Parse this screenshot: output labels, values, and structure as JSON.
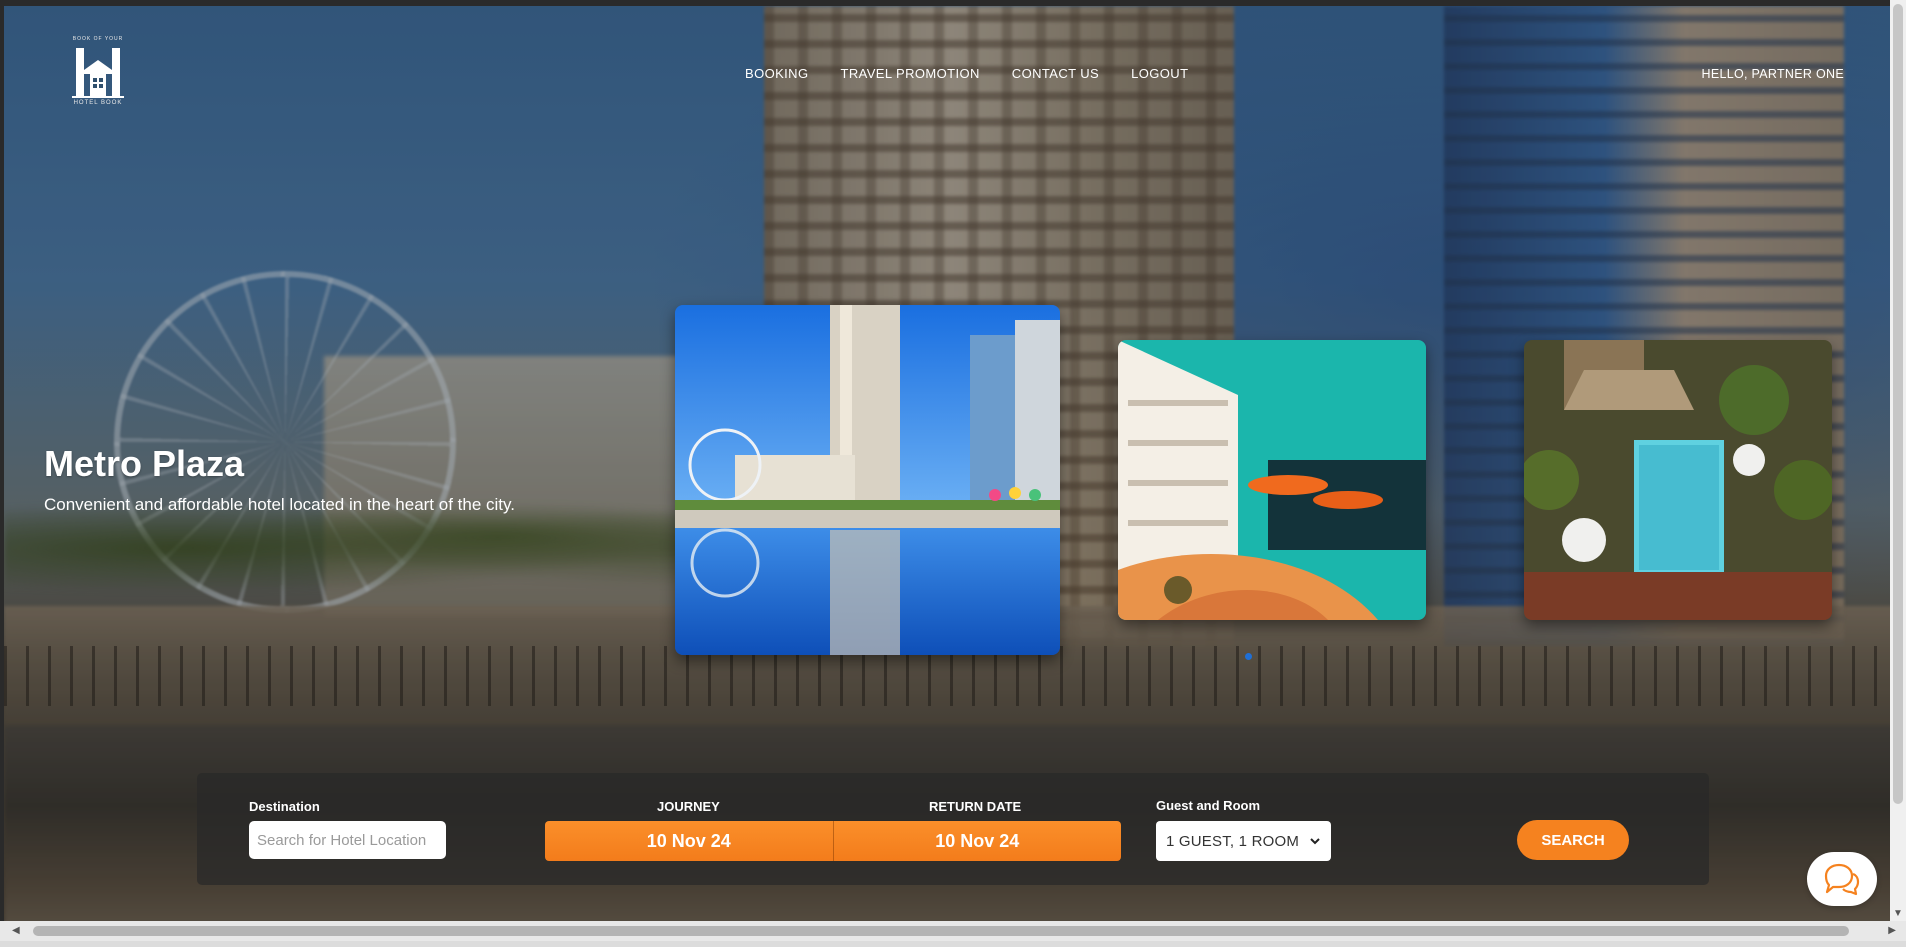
{
  "logo": {
    "tagline": "BOOK OF YOUR",
    "name": "HOTEL BOOK"
  },
  "nav": {
    "items": [
      "BOOKING",
      "TRAVEL PROMOTION",
      "CONTACT US",
      "LOGOUT"
    ]
  },
  "user": {
    "greeting": "HELLO, PARTNER ONE"
  },
  "hero": {
    "title": "Metro Plaza",
    "description": "Convenient and affordable hotel located in the heart of the city.",
    "active_slide": 1
  },
  "search": {
    "destination_label": "Destination",
    "destination_placeholder": "Search for Hotel Location",
    "destination_value": "",
    "journey_label": "JOURNEY",
    "journey_value": "10 Nov 24",
    "return_label": "RETURN DATE",
    "return_value": "10 Nov 24",
    "guest_label": "Guest and Room",
    "guest_value": "1 GUEST, 1 ROOM",
    "search_button": "SEARCH"
  },
  "colors": {
    "accent": "#f5821f",
    "slide_dot": "#1f6fd6",
    "panel": "rgba(40,40,40,.72)"
  },
  "icons": {
    "chat": "chat-bubbles-icon",
    "chevron": "chevron-down-icon"
  }
}
